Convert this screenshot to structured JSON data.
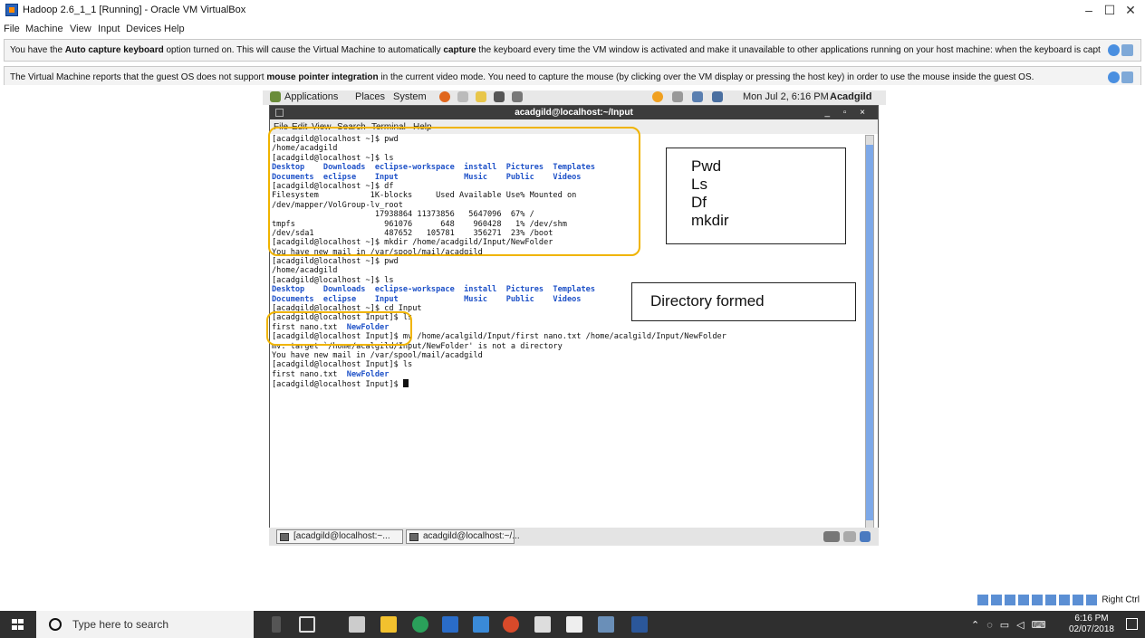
{
  "window": {
    "title": "Hadoop 2.6_1_1 [Running] - Oracle VM VirtualBox",
    "controls": {
      "minimize": "–",
      "maximize": "☐",
      "close": "✕"
    }
  },
  "menubar": [
    "File",
    "Machine",
    "View",
    "Input",
    "Devices",
    "Help"
  ],
  "notices": [
    {
      "pre": "You have the ",
      "bold1": "Auto capture keyboard",
      "mid": " option turned on. This will cause the Virtual Machine to automatically ",
      "bold2": "capture",
      "post": " the keyboard every time the VM window is activated and make it unavailable to other applications running on your host machine: when the keyboard is captured, all keystrokes (including system ones like"
    },
    {
      "pre": "The Virtual Machine reports that the guest OS does not support ",
      "bold1": "mouse pointer integration",
      "mid": " in the current video mode. You need to capture the mouse (by clicking over the VM display or pressing the host key) in order to use the mouse inside the guest OS.",
      "bold2": "",
      "post": ""
    }
  ],
  "gnome_panel": {
    "menus": [
      "Applications",
      "Places",
      "System"
    ],
    "datetime": "Mon Jul  2,  6:16 PM",
    "user": "Acadgild"
  },
  "terminal": {
    "title": "acadgild@localhost:~/Input",
    "buttons": "_ ▫ ×",
    "menu": [
      "File",
      "Edit",
      "View",
      "Search",
      "Terminal",
      "Help"
    ],
    "lines": [
      {
        "t": "[acadgild@localhost ~]$ pwd"
      },
      {
        "t": "/home/acadgild"
      },
      {
        "t": "[acadgild@localhost ~]$ ls"
      },
      {
        "t": "Desktop    Downloads  eclipse-workspace  install  Pictures  Templates",
        "blue": true
      },
      {
        "t": "Documents  eclipse    Input              Music    Public    Videos",
        "blue": true
      },
      {
        "t": "[acadgild@localhost ~]$ df"
      },
      {
        "t": "Filesystem           1K-blocks     Used Available Use% Mounted on"
      },
      {
        "t": "/dev/mapper/VolGroup-lv_root"
      },
      {
        "t": "                      17938864 11373856   5647096  67% /"
      },
      {
        "t": "tmpfs                   961076      648    960428   1% /dev/shm"
      },
      {
        "t": "/dev/sda1               487652   105781    356271  23% /boot"
      },
      {
        "t": "[acadgild@localhost ~]$ mkdir /home/acadgild/Input/NewFolder"
      },
      {
        "t": "You have new mail in /var/spool/mail/acadgild"
      },
      {
        "t": "[acadgild@localhost ~]$ pwd"
      },
      {
        "t": "/home/acadgild"
      },
      {
        "t": "[acadgild@localhost ~]$ ls"
      },
      {
        "t": "Desktop    Downloads  eclipse-workspace  install  Pictures  Templates",
        "blue": true
      },
      {
        "t": "Documents  eclipse    Input              Music    Public    Videos",
        "blue": true
      },
      {
        "t": "[acadgild@localhost ~]$ cd Input"
      },
      {
        "t": "[acadgild@localhost Input]$ ls"
      },
      {
        "t": "first nano.txt  ",
        "b": "NewFolder"
      },
      {
        "t": "[acadgild@localhost Input]$ mv /home/acalgild/Input/first nano.txt /home/acalgild/Input/NewFolder"
      },
      {
        "t": "mv: target `/home/acalgild/Input/NewFolder' is not a directory"
      },
      {
        "t": "You have new mail in /var/spool/mail/acadgild"
      },
      {
        "t": "[acadgild@localhost Input]$ ls"
      },
      {
        "t": "first nano.txt  ",
        "b": "NewFolder"
      },
      {
        "t": "[acadgild@localhost Input]$ ",
        "cursor": true
      }
    ]
  },
  "notes": {
    "commands": [
      "Pwd",
      "Ls",
      "Df",
      "mkdir"
    ],
    "directory": "Directory formed"
  },
  "vm_taskbar": {
    "btn1": "[acadgild@localhost:~...",
    "btn2": "acadgild@localhost:~/..."
  },
  "host_key": "Right Ctrl",
  "windows_taskbar": {
    "search_placeholder": "Type here to search",
    "time": "6:16 PM",
    "date": "02/07/2018"
  }
}
